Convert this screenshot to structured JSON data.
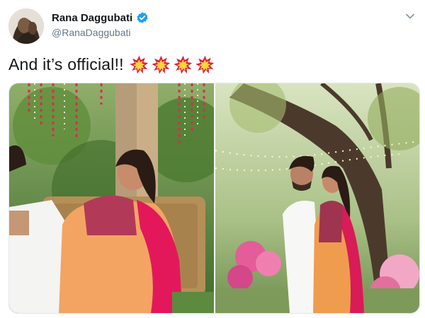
{
  "tweet": {
    "author": {
      "display_name": "Rana Daggubati",
      "handle": "@RanaDaggubati",
      "verified": true,
      "avatar_icon": "profile-photo"
    },
    "text": "And it’s official!!",
    "emojis": [
      "collision-emoji",
      "collision-emoji",
      "collision-emoji",
      "collision-emoji"
    ],
    "menu_icon": "chevron-down-icon",
    "media": [
      {
        "kind": "photo",
        "description_icon": "couple-seated-photo"
      },
      {
        "kind": "photo",
        "description_icon": "couple-standing-photo"
      }
    ]
  },
  "colors": {
    "verified_blue": "#1da1f2",
    "name": "#14171a",
    "handle": "#657786",
    "burst_red": "#d91f3b",
    "burst_yellow": "#ffd33b"
  }
}
